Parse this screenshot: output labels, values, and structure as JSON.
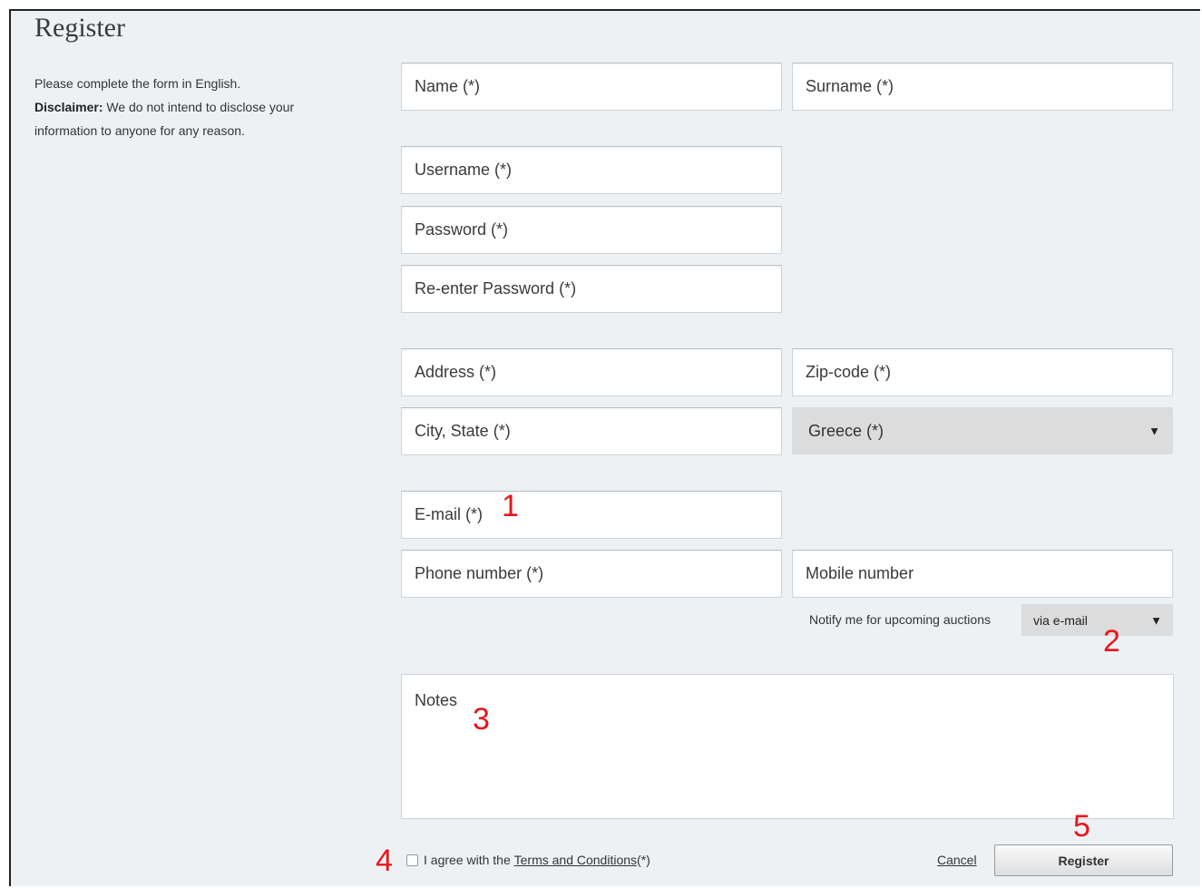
{
  "page": {
    "title": "Register"
  },
  "intro": {
    "line1": "Please complete the form in English.",
    "disclaimer_label": "Disclaimer:",
    "disclaimer_text": " We do not intend to disclose your information to anyone for any reason."
  },
  "fields": {
    "name": "Name (*)",
    "surname": "Surname (*)",
    "username": "Username (*)",
    "password": "Password (*)",
    "reenter_password": "Re-enter Password (*)",
    "address": "Address (*)",
    "zipcode": "Zip-code (*)",
    "city_state": "City, State (*)",
    "email": "E-mail (*)",
    "phone": "Phone number (*)",
    "mobile": "Mobile number",
    "notes": "Notes"
  },
  "country_select": {
    "selected": "Greece (*)"
  },
  "notify": {
    "label": "Notify me for upcoming auctions",
    "selected": "via e-mail"
  },
  "agreement": {
    "prefix": "I agree with the ",
    "link": "Terms and Conditions",
    "suffix": " (*)"
  },
  "actions": {
    "cancel": "Cancel",
    "register": "Register"
  },
  "markers": {
    "m1": "1",
    "m2": "2",
    "m3": "3",
    "m4": "4",
    "m5": "5"
  },
  "icons": {
    "caret": "caret-down-icon"
  },
  "colors": {
    "marker": "#e8161b",
    "background": "#eef1f4",
    "select_bg": "#dcdcdc"
  }
}
